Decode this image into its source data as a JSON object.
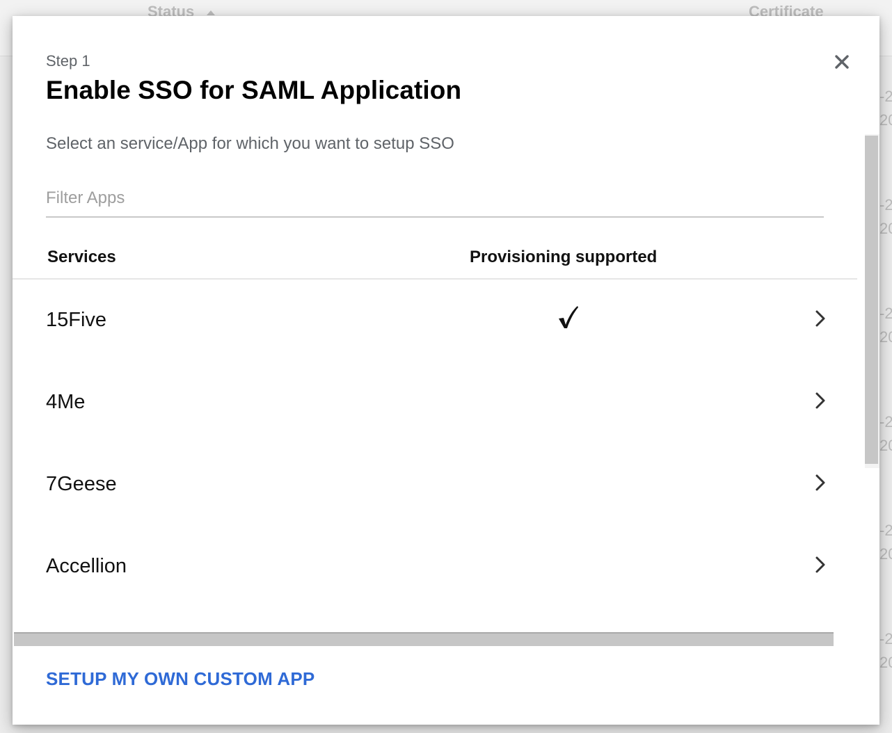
{
  "background": {
    "columns": [
      "Status",
      "Certificate"
    ],
    "edge_fragments": [
      "-2",
      "20",
      "-2",
      "20",
      "-2",
      "20",
      "-2",
      "20",
      "-2",
      "20",
      "-2",
      "20"
    ]
  },
  "dialog": {
    "step_label": "Step 1",
    "title": "Enable SSO for SAML Application",
    "subtitle": "Select an service/App for which you want to setup SSO",
    "filter_placeholder": "Filter Apps",
    "filter_value": "",
    "close_icon": "close-icon",
    "columns": {
      "services": "Services",
      "provisioning": "Provisioning supported"
    },
    "apps": [
      {
        "name": "15Five",
        "provisioning": true
      },
      {
        "name": "4Me",
        "provisioning": false
      },
      {
        "name": "7Geese",
        "provisioning": false
      },
      {
        "name": "Accellion",
        "provisioning": false
      }
    ],
    "footer_link": "SETUP MY OWN CUSTOM APP"
  },
  "colors": {
    "accent_link": "#2f6ad6",
    "title": "#000000",
    "muted_text": "#5f6368"
  }
}
